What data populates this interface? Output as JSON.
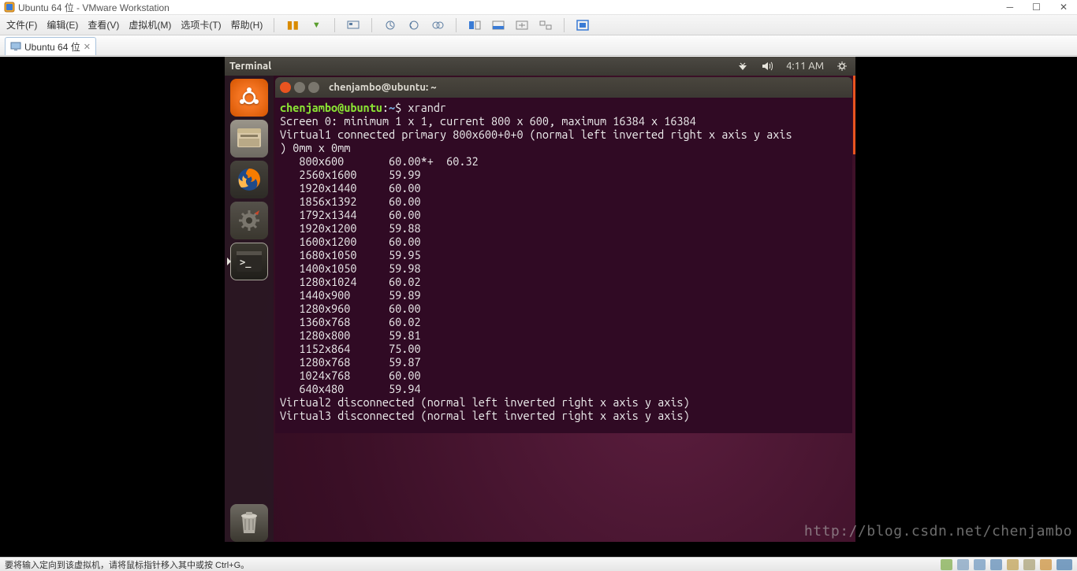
{
  "vmware": {
    "title": "Ubuntu 64 位 - VMware Workstation",
    "menu": {
      "file": "文件(F)",
      "edit": "编辑(E)",
      "view": "查看(V)",
      "vm": "虚拟机(M)",
      "tabs": "选项卡(T)",
      "help": "帮助(H)"
    },
    "tab": {
      "label": "Ubuntu 64 位"
    },
    "status": "要将输入定向到该虚拟机，请将鼠标指针移入其中或按 Ctrl+G。"
  },
  "ubuntu": {
    "panel_title": "Terminal",
    "clock": "4:11 AM"
  },
  "terminal": {
    "title": "chenjambo@ubuntu: ~",
    "prompt_user": "chenjambo@ubuntu",
    "prompt_path": "~",
    "command": "xrandr",
    "output_head1": "Screen 0: minimum 1 x 1, current 800 x 600, maximum 16384 x 16384",
    "output_head2": "Virtual1 connected primary 800x600+0+0 (normal left inverted right x axis y axis",
    "output_head3": ") 0mm x 0mm",
    "modes": [
      {
        "res": "800x600",
        "rate": "60.00*+  60.32"
      },
      {
        "res": "2560x1600",
        "rate": "59.99"
      },
      {
        "res": "1920x1440",
        "rate": "60.00"
      },
      {
        "res": "1856x1392",
        "rate": "60.00"
      },
      {
        "res": "1792x1344",
        "rate": "60.00"
      },
      {
        "res": "1920x1200",
        "rate": "59.88"
      },
      {
        "res": "1600x1200",
        "rate": "60.00"
      },
      {
        "res": "1680x1050",
        "rate": "59.95"
      },
      {
        "res": "1400x1050",
        "rate": "59.98"
      },
      {
        "res": "1280x1024",
        "rate": "60.02"
      },
      {
        "res": "1440x900",
        "rate": "59.89"
      },
      {
        "res": "1280x960",
        "rate": "60.00"
      },
      {
        "res": "1360x768",
        "rate": "60.02"
      },
      {
        "res": "1280x800",
        "rate": "59.81"
      },
      {
        "res": "1152x864",
        "rate": "75.00"
      },
      {
        "res": "1280x768",
        "rate": "59.87"
      },
      {
        "res": "1024x768",
        "rate": "60.00"
      },
      {
        "res": "640x480",
        "rate": "59.94"
      }
    ],
    "output_tail1": "Virtual2 disconnected (normal left inverted right x axis y axis)",
    "output_tail2": "Virtual3 disconnected (normal left inverted right x axis y axis)"
  },
  "watermark": "http://blog.csdn.net/chenjambo"
}
